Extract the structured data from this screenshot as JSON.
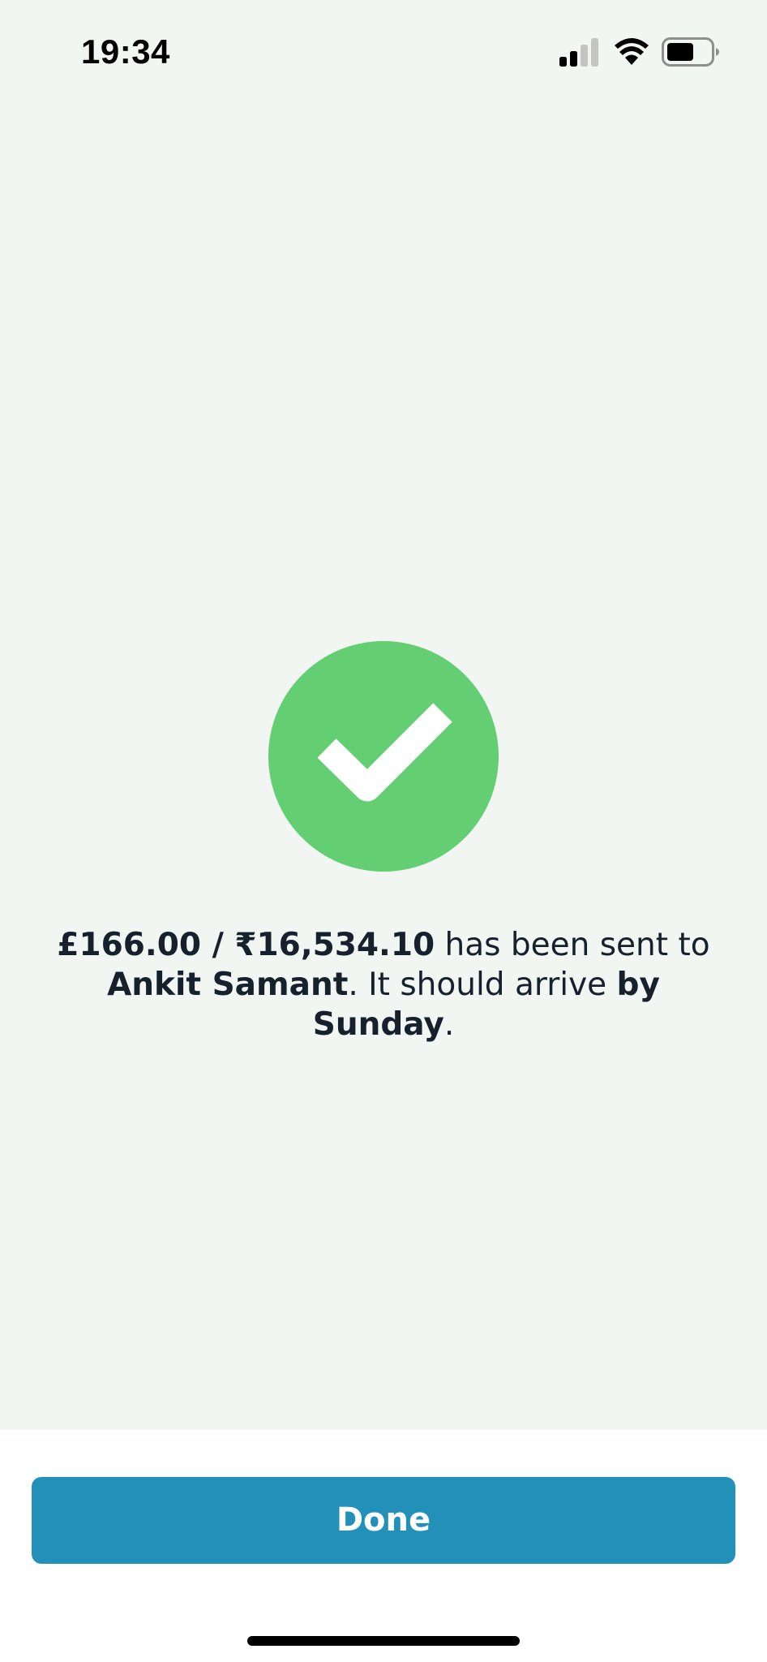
{
  "status_bar": {
    "time": "19:34",
    "icons": [
      "signal-icon",
      "wifi-icon",
      "battery-icon"
    ]
  },
  "confirmation": {
    "icon": "checkmark-icon",
    "amount": "£166.00 / ₹16,534.10",
    "sent_to_text": " has been sent to ",
    "recipient": "Ankit Samant",
    "arrival_text": ". It should arrive ",
    "arrival_time": "by Sunday",
    "end_punctuation": "."
  },
  "actions": {
    "done_label": "Done"
  },
  "colors": {
    "background": "#f1f6f2",
    "success_green": "#64ce72",
    "button_blue": "#2290b8",
    "text_dark": "#17212e"
  }
}
